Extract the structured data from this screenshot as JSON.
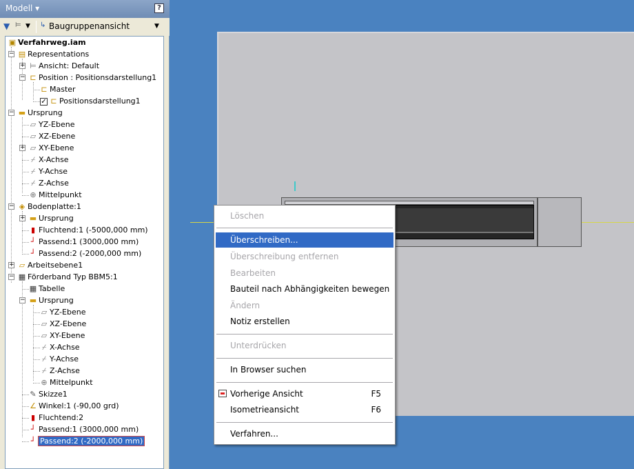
{
  "panel": {
    "title": "Modell ▾",
    "help": "?",
    "filter_icon": "funnel-icon",
    "view_dropdown": "Baugruppenansicht"
  },
  "tree": {
    "root": "Verfahrweg.iam",
    "items": [
      {
        "label": "Representations"
      },
      {
        "label": "Ansicht: Default"
      },
      {
        "label": "Position : Positionsdarstellung1"
      },
      {
        "label": "Master"
      },
      {
        "label": "Positionsdarstellung1"
      },
      {
        "label": "Ursprung"
      },
      {
        "label": "YZ-Ebene"
      },
      {
        "label": "XZ-Ebene"
      },
      {
        "label": "XY-Ebene"
      },
      {
        "label": "X-Achse"
      },
      {
        "label": "Y-Achse"
      },
      {
        "label": "Z-Achse"
      },
      {
        "label": "Mittelpunkt"
      },
      {
        "label": "Bodenplatte:1"
      },
      {
        "label": "Ursprung"
      },
      {
        "label": "Fluchtend:1 (-5000,000 mm)"
      },
      {
        "label": "Passend:1 (3000,000 mm)"
      },
      {
        "label": "Passend:2 (-2000,000 mm)"
      },
      {
        "label": "Arbeitsebene1"
      },
      {
        "label": "Förderband Typ BBM5:1"
      },
      {
        "label": "Tabelle"
      },
      {
        "label": "Ursprung"
      },
      {
        "label": "YZ-Ebene"
      },
      {
        "label": "XZ-Ebene"
      },
      {
        "label": "XY-Ebene"
      },
      {
        "label": "X-Achse"
      },
      {
        "label": "Y-Achse"
      },
      {
        "label": "Z-Achse"
      },
      {
        "label": "Mittelpunkt"
      },
      {
        "label": "Skizze1"
      },
      {
        "label": "Winkel:1 (-90,00 grd)"
      },
      {
        "label": "Fluchtend:2"
      },
      {
        "label": "Passend:1 (3000,000 mm)"
      },
      {
        "label": "Passend:2 (-2000,000 mm)"
      }
    ]
  },
  "menu": {
    "items": [
      {
        "label": "Löschen",
        "enabled": false
      },
      {
        "label": "Überschreiben...",
        "enabled": true,
        "highlighted": true
      },
      {
        "label": "Überschreibung entfernen",
        "enabled": false
      },
      {
        "label": "Bearbeiten",
        "enabled": false
      },
      {
        "label": "Bauteil nach Abhängigkeiten bewegen",
        "enabled": true
      },
      {
        "label": "Ändern",
        "enabled": false
      },
      {
        "label": "Notiz erstellen",
        "enabled": true
      },
      {
        "label": "Unterdrücken",
        "enabled": false
      },
      {
        "label": "In Browser suchen",
        "enabled": true
      },
      {
        "label": "Vorherige Ansicht",
        "enabled": true,
        "shortcut": "F5"
      },
      {
        "label": "Isometrieansicht",
        "enabled": true,
        "shortcut": "F6"
      },
      {
        "label": "Verfahren...",
        "enabled": true
      }
    ]
  },
  "colors": {
    "viewport_bg": "#4a82c0",
    "sheet": "#c4c4c8",
    "selection": "#316ac5",
    "axis_x": "#d7d746",
    "axis_y": "#3fc9c9"
  }
}
